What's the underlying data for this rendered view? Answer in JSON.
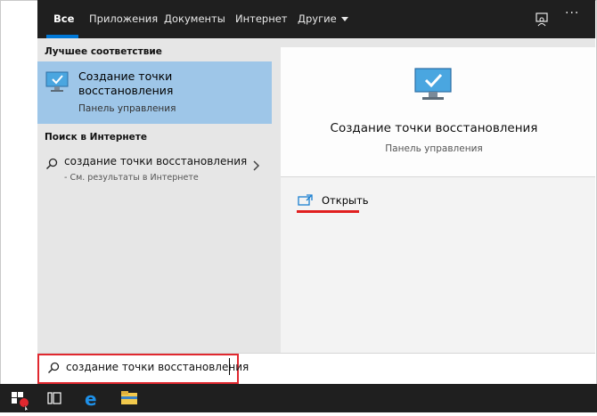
{
  "tabs": [
    {
      "label": "Все",
      "active": true
    },
    {
      "label": "Приложения",
      "active": false
    },
    {
      "label": "Документы",
      "active": false
    },
    {
      "label": "Интернет",
      "active": false
    },
    {
      "label": "Другие",
      "active": false
    }
  ],
  "topbar_icons": [
    "feedback-icon",
    "more-options-icon"
  ],
  "more_label": "···",
  "best_match": {
    "section_label": "Лучшее соответствие",
    "title": "Создание точки восстановления",
    "subtitle": "Панель управления",
    "icon": "monitor-check-icon"
  },
  "web_search": {
    "section_label": "Поиск в Интернете",
    "query": "создание точки восстановления",
    "hint": "- См. результаты в Интернете"
  },
  "details": {
    "title": "Создание точки восстановления",
    "subtitle": "Панель управления",
    "open_label": "Открыть"
  },
  "search": {
    "value": "создание точки восстановления"
  },
  "taskbar": [
    "windows-start-icon",
    "task-view-icon",
    "edge-icon",
    "file-explorer-icon"
  ],
  "colors": {
    "accent": "#0078d7",
    "highlight": "#e0282f",
    "selected_row": "#9ec6e8",
    "topbar": "#1f1f1f"
  }
}
